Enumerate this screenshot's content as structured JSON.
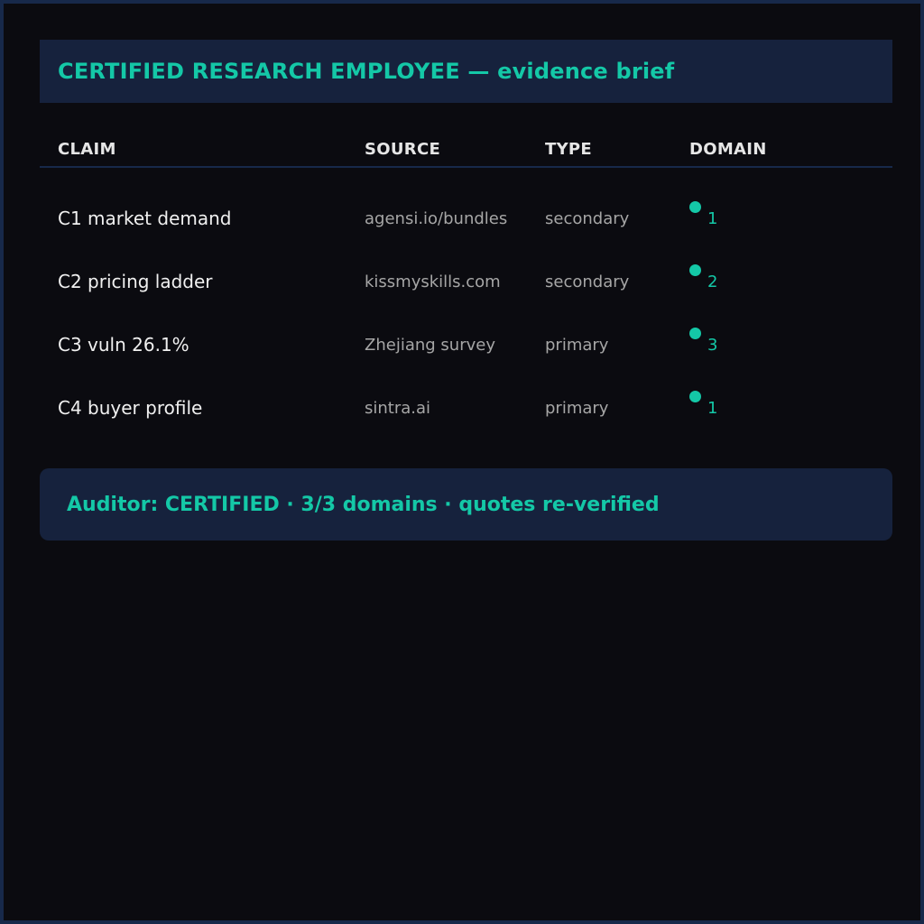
{
  "header": {
    "title": "CERTIFIED RESEARCH EMPLOYEE — evidence brief"
  },
  "table": {
    "columns": {
      "claim": "CLAIM",
      "source": "SOURCE",
      "type": "TYPE",
      "domain": "DOMAIN"
    },
    "rows": [
      {
        "claim": "C1 market demand",
        "source": "agensi.io/bundles",
        "type": "secondary",
        "domain": "1"
      },
      {
        "claim": "C2 pricing ladder",
        "source": "kissmyskills.com",
        "type": "secondary",
        "domain": "2"
      },
      {
        "claim": "C3 vuln 26.1%",
        "source": "Zhejiang survey",
        "type": "primary",
        "domain": "3"
      },
      {
        "claim": "C4 buyer profile",
        "source": "sintra.ai",
        "type": "primary",
        "domain": "1"
      }
    ]
  },
  "footer": {
    "status": "Auditor: CERTIFIED · 3/3 domains · quotes re-verified"
  },
  "colors": {
    "accent": "#14c8a7",
    "panel": "#16223d",
    "background": "#0b0b10",
    "border": "#17294a"
  }
}
